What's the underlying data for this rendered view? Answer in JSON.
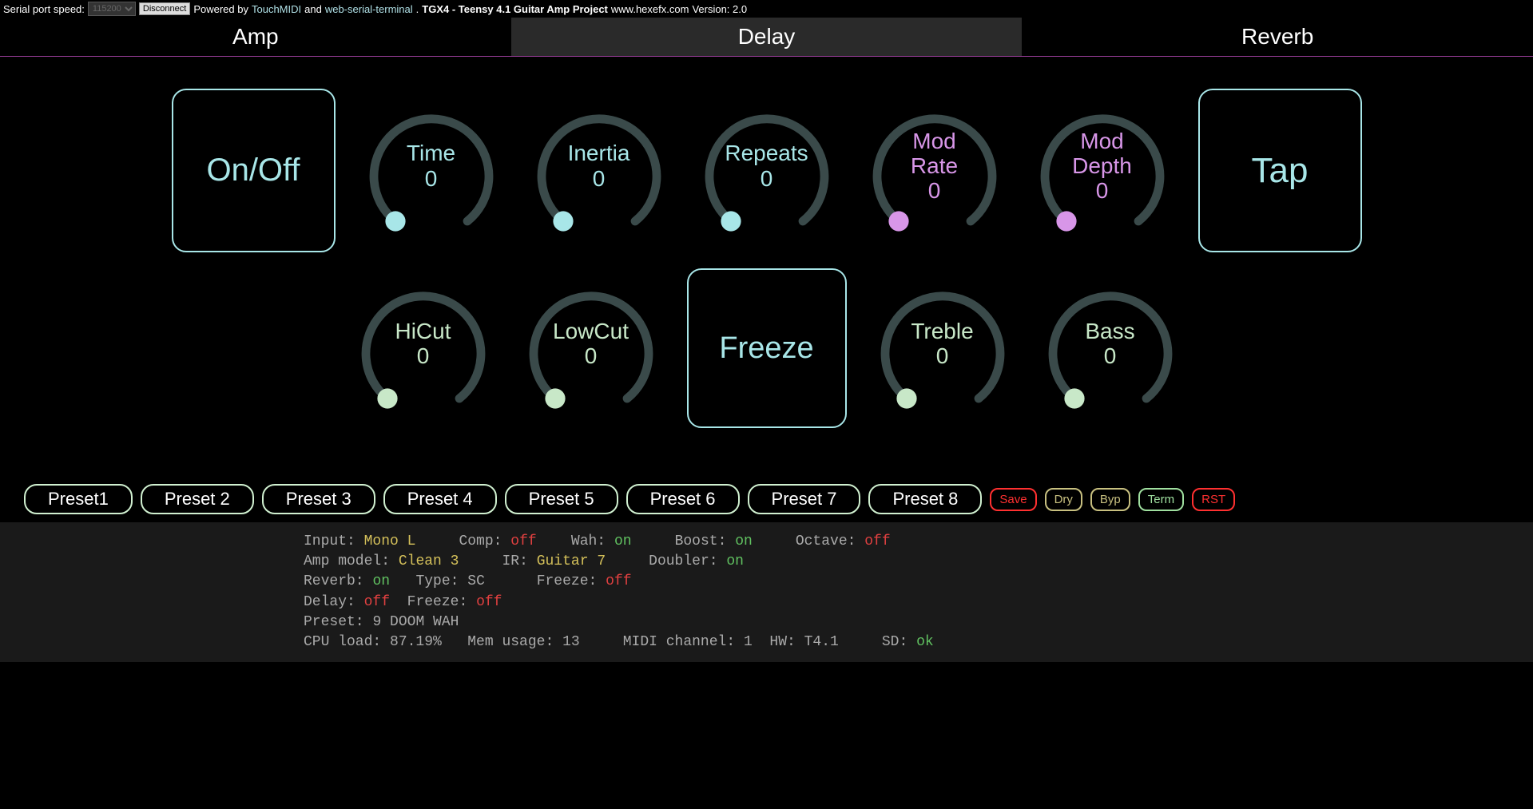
{
  "header": {
    "serial_label": "Serial port speed:",
    "speed": "115200",
    "disconnect": "Disconnect",
    "powered": "Powered by",
    "touchmidi": "TouchMIDI",
    "and": "and",
    "webserial": "web-serial-terminal",
    "project": "TGX4 - Teensy 4.1 Guitar Amp Project",
    "site": "www.hexefx.com",
    "version": "Version: 2.0"
  },
  "tabs": {
    "amp": "Amp",
    "delay": "Delay",
    "reverb": "Reverb"
  },
  "buttons": {
    "onoff": "On/Off",
    "tap": "Tap",
    "freeze": "Freeze"
  },
  "knobs": {
    "time": {
      "label": "Time",
      "val": "0"
    },
    "inertia": {
      "label": "Inertia",
      "val": "0"
    },
    "repeats": {
      "label": "Repeats",
      "val": "0"
    },
    "modrate": {
      "label": "Mod\nRate",
      "val": "0"
    },
    "moddepth": {
      "label": "Mod\nDepth",
      "val": "0"
    },
    "hicut": {
      "label": "HiCut",
      "val": "0"
    },
    "lowcut": {
      "label": "LowCut",
      "val": "0"
    },
    "treble": {
      "label": "Treble",
      "val": "0"
    },
    "bass": {
      "label": "Bass",
      "val": "0"
    }
  },
  "presets": [
    "Preset1",
    "Preset 2",
    "Preset 3",
    "Preset 4",
    "Preset 5",
    "Preset 6",
    "Preset 7",
    "Preset 8"
  ],
  "small": {
    "save": "Save",
    "dry": "Dry",
    "byp": "Byp",
    "term": "Term",
    "rst": "RST"
  },
  "term": {
    "input_l": "Input:",
    "input_v": "Mono L",
    "comp_l": "Comp:",
    "comp_v": "off",
    "wah_l": "Wah:",
    "wah_v": "on",
    "boost_l": "Boost:",
    "boost_v": "on",
    "octave_l": "Octave:",
    "octave_v": "off",
    "amp_l": "Amp model:",
    "amp_v": "Clean 3",
    "ir_l": "IR:",
    "ir_v": "Guitar 7",
    "doubler_l": "Doubler:",
    "doubler_v": "on",
    "reverb_l": "Reverb:",
    "reverb_v": "on",
    "type_l": "Type:",
    "type_v": "SC",
    "freeze_l": "Freeze:",
    "freeze_v": "off",
    "delay_l": "Delay:",
    "delay_v": "off",
    "freeze2_l": "Freeze:",
    "freeze2_v": "off",
    "preset_l": "Preset:",
    "preset_v": "9 DOOM WAH",
    "cpu_l": "CPU load:",
    "cpu_v": "87.19%",
    "mem_l": "Mem usage:",
    "mem_v": "13",
    "midi_l": "MIDI channel:",
    "midi_v": "1",
    "hw_l": "HW:",
    "hw_v": "T4.1",
    "sd_l": "SD:",
    "sd_v": "ok"
  }
}
